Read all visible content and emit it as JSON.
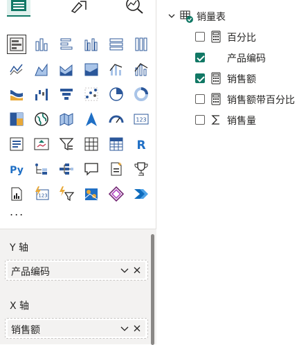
{
  "visualizations": {
    "more_label": "...",
    "data_labels": {
      "table": "123",
      "r": "R",
      "python": "Py"
    }
  },
  "wells": {
    "y_axis": {
      "label": "Y 轴",
      "field": "产品编码"
    },
    "x_axis": {
      "label": "X 轴",
      "field": "销售额"
    }
  },
  "fields": {
    "table_name": "销量表",
    "items": [
      {
        "name": "百分比",
        "checked": false,
        "icon": "calculator-icon"
      },
      {
        "name": "产品编码",
        "checked": true,
        "icon": "none"
      },
      {
        "name": "销售额",
        "checked": true,
        "icon": "calculator-icon"
      },
      {
        "name": "销售额带百分比",
        "checked": false,
        "icon": "calculator-icon"
      },
      {
        "name": "销售量",
        "checked": false,
        "icon": "sigma-icon"
      }
    ]
  },
  "colors": {
    "accent": "#117865",
    "pane_bg": "#f3f2f1"
  }
}
